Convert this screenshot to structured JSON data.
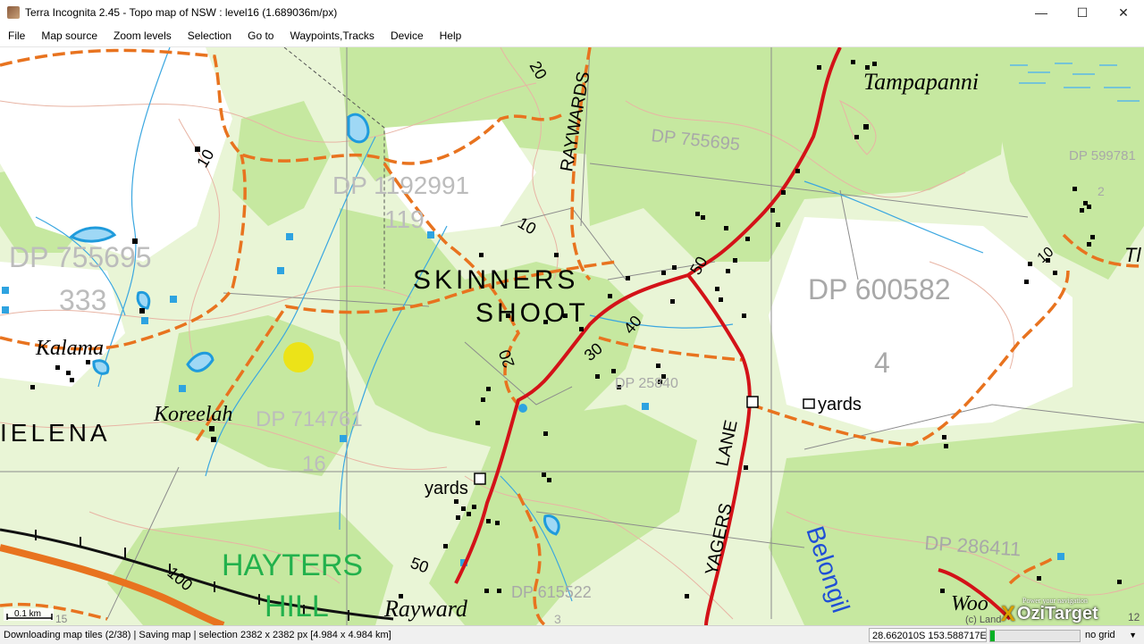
{
  "window": {
    "title": "Terra Incognita 2.45 - Topo map of NSW : level16 (1.689036m/px)",
    "controls": {
      "minimize": "—",
      "maximize": "☐",
      "close": "✕"
    }
  },
  "menu": [
    "File",
    "Map source",
    "Zoom levels",
    "Selection",
    "Go to",
    "Waypoints,Tracks",
    "Device",
    "Help"
  ],
  "map": {
    "place_names": {
      "skinners_line1": "SKINNERS",
      "skinners_line2": "SHOOT",
      "helena": "IELENA",
      "hayters_line1": "HAYTERS",
      "hayters_line2": "HILL",
      "kalama": "Kalama",
      "koreelah": "Koreelah",
      "tampapanni": "Tampapanni",
      "rayward": "Rayward",
      "yards1": "yards",
      "yards2": "yards",
      "belongil": "Belongil",
      "wood": "Woo"
    },
    "road_names": {
      "raywards": "RAYWARDS",
      "yagers": "YAGERS",
      "lane": "LANE"
    },
    "lots": {
      "dp755695_left": "DP 755695",
      "lot333": "333",
      "dp1192991": "DP 1192991",
      "lot119": "119",
      "dp755695_top": "DP 755695",
      "dp599781": "DP 599781",
      "dp600582": "DP 600582",
      "lot4": "4",
      "dp714761": "DP 714761",
      "lot16": "16",
      "dp25840": "DP 25840",
      "dp286411": "DP 286411",
      "dp615522": "DP 615522",
      "lot2": "2",
      "lot3": "3",
      "lot12": "12",
      "tl": "Tl",
      "copyright": "(c) Land"
    },
    "contour_labels": [
      "10",
      "20",
      "10",
      "20",
      "30",
      "40",
      "50",
      "100",
      "50",
      "10",
      "15"
    ],
    "scale_label": "0.1 km"
  },
  "status": {
    "message": "Downloading map tiles (2/38) | Saving map  | selection 2382 x 2382 px [4.984 x 4.984 km]",
    "coords": "28.662010S 153.588717E",
    "progress_fraction": 0.05,
    "grid": "no grid"
  },
  "watermark": {
    "tagline": "Power your navigation",
    "brand": "OziTarget",
    "brand_x": "X"
  }
}
